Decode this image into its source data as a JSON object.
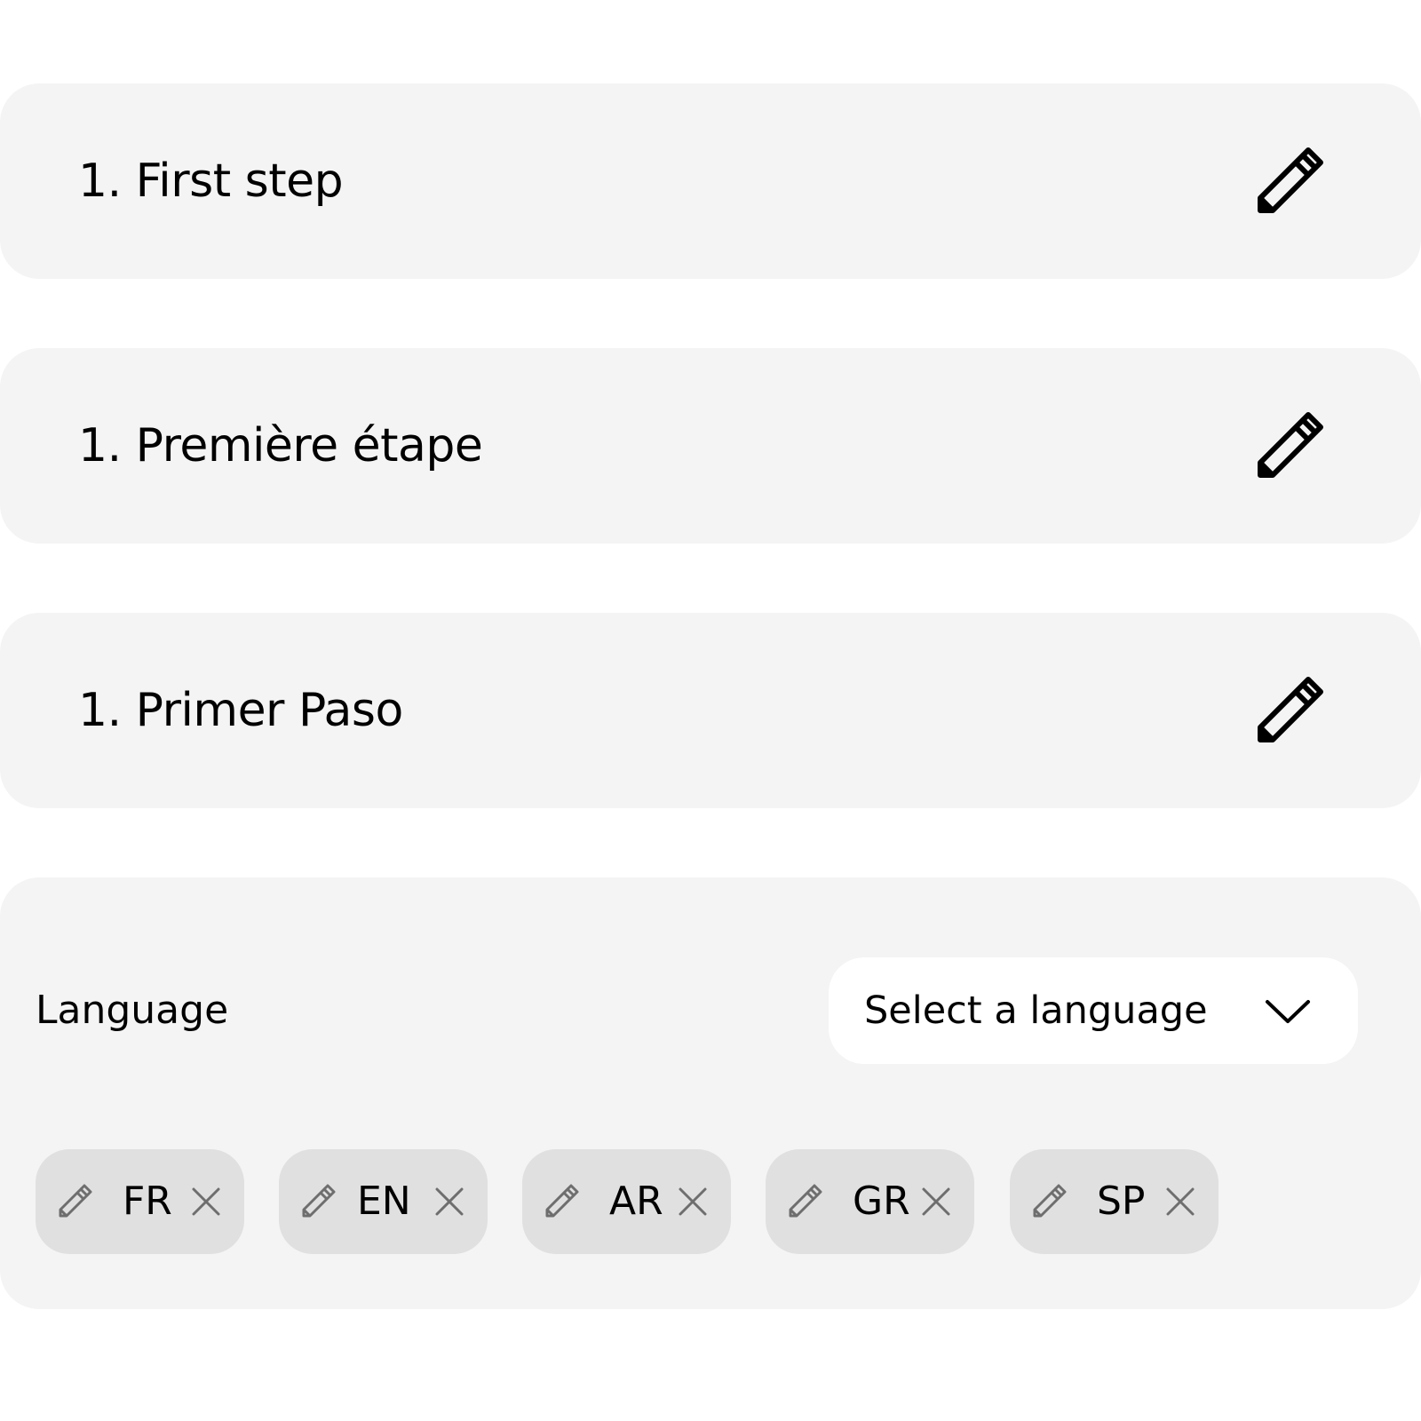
{
  "steps": [
    {
      "label": "1. First step"
    },
    {
      "label": "1. Première étape"
    },
    {
      "label": "1. Primer Paso"
    }
  ],
  "language_panel": {
    "label": "Language",
    "select": {
      "value": "Select a language",
      "icon": "chevron-down-icon"
    },
    "chips": [
      {
        "code": "FR"
      },
      {
        "code": "EN"
      },
      {
        "code": "AR"
      },
      {
        "code": "GR"
      },
      {
        "code": "SP"
      }
    ]
  },
  "colors": {
    "card_background": "#f4f4f4",
    "chip_background": "#e0e0e0",
    "select_background": "#ffffff",
    "chip_icon": "#6e6e6e"
  }
}
